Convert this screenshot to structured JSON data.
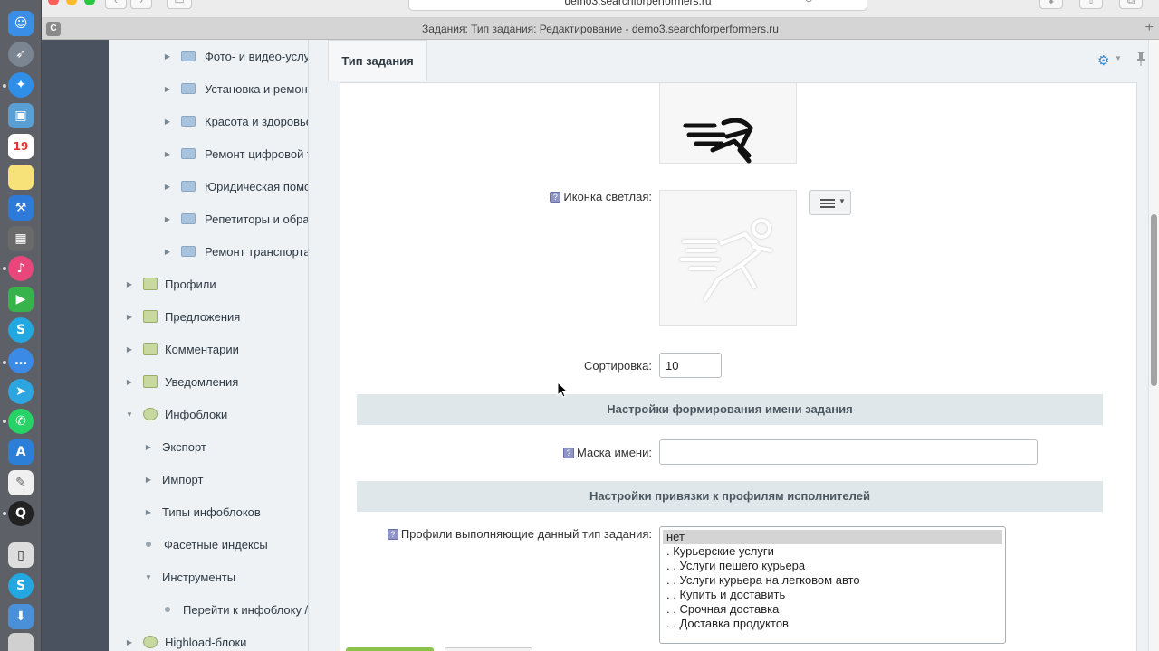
{
  "browser": {
    "url": "demo3.searchforperformers.ru",
    "tab_title": "Задания: Тип задания: Редактирование - demo3.searchforperformers.ru",
    "tab_favicon": "C"
  },
  "dock": {
    "calendar_day": "19"
  },
  "tree": {
    "folders": [
      "Фото- и видео-услуги",
      "Установка и ремонт",
      "Красота и здоровье",
      "Ремонт цифровой т",
      "Юридическая помощь",
      "Репетиторы и образ",
      "Ремонт транспорта"
    ],
    "sections": [
      "Профили",
      "Предложения",
      "Комментарии",
      "Уведомления"
    ],
    "infoblocks": "Инфоблоки",
    "infoblock_children": [
      "Экспорт",
      "Импорт",
      "Типы инфоблоков"
    ],
    "facet": "Фасетные индексы",
    "tools": "Инструменты",
    "tools_child": "Перейти к инфоблоку /",
    "highload": "Highload-блоки"
  },
  "main": {
    "tab_label": "Тип задания",
    "icon_light_label": "Иконка светлая:",
    "sort_label": "Сортировка:",
    "sort_value": "10",
    "section_name_settings": "Настройки формирования имени задания",
    "name_mask_label": "Маска имени:",
    "name_mask_value": "",
    "section_profile_binding": "Настройки привязки к профилям исполнителей",
    "profiles_label": "Профили выполняющие данный тип задания:",
    "profiles_options": [
      "нет",
      ". Курьерские услуги",
      ". . Услуги пешего курьера",
      ". . Услуги курьера на легковом авто",
      ". . Купить и доставить",
      ". . Срочная доставка",
      ". . Доставка продуктов"
    ],
    "profiles_selected": "нет",
    "hint_glyph": "?"
  },
  "colors": {
    "accent_blue": "#3d85c6",
    "save_button_green": "#8bc34a",
    "dark_strip": "#4a5260"
  }
}
